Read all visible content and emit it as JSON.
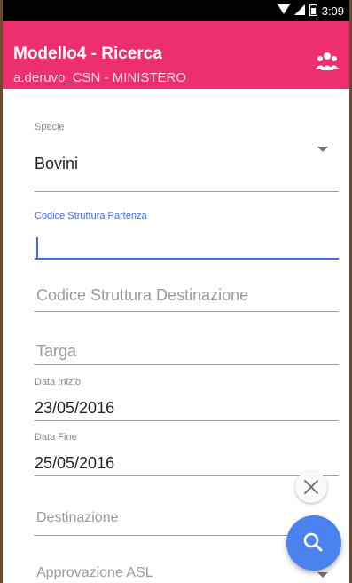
{
  "status_bar": {
    "time": "3:09",
    "icons": [
      "wifi-icon",
      "signal-icon",
      "battery-icon"
    ]
  },
  "app_bar": {
    "title": "Modello4 - Ricerca",
    "subtitle": "a.deruvo_CSN - MINISTERO",
    "action_icon": "group-icon",
    "color": "#ee2f6d"
  },
  "form": {
    "specie": {
      "label": "Specie",
      "value": "Bovini"
    },
    "codice_partenza": {
      "label": "Codice Struttura Partenza",
      "value": ""
    },
    "codice_destinazione": {
      "placeholder": "Codice Struttura Destinazione"
    },
    "targa": {
      "placeholder": "Targa"
    },
    "data_inizio": {
      "label": "Data Inizio",
      "value": "23/05/2016"
    },
    "data_fine": {
      "label": "Data Fine",
      "value": "25/05/2016"
    },
    "destinazione": {
      "placeholder": "Destinazione"
    },
    "approvazione": {
      "placeholder": "Approvazione ASL"
    }
  },
  "fabs": {
    "clear_icon": "close-icon",
    "search_icon": "search-icon",
    "search_color": "#4a83f0"
  },
  "colors": {
    "accent": "#3f6bf0"
  }
}
